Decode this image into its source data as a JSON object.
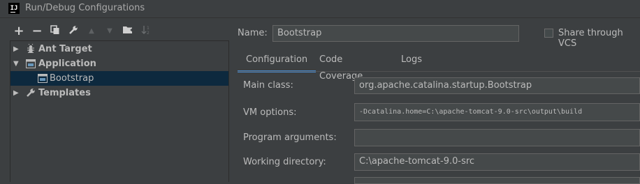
{
  "window": {
    "title": "Run/Debug Configurations",
    "logo_text": "IJ"
  },
  "toolbar": {
    "add": "+",
    "remove": "−",
    "copy": "⧉",
    "wrench": "🔧",
    "up": "▲",
    "down": "▼",
    "folder": "📁",
    "sort": "↓²"
  },
  "tree": {
    "items": [
      {
        "label": "Ant Target",
        "icon": "ant-icon"
      },
      {
        "label": "Application",
        "icon": "application-icon"
      },
      {
        "label": "Bootstrap",
        "icon": "application-config-icon"
      },
      {
        "label": "Templates",
        "icon": "wrench-icon"
      }
    ]
  },
  "form": {
    "name_label": "Name:",
    "name_value": "Bootstrap",
    "share_label": "Share through VCS",
    "tabs": [
      "Configuration",
      "Code Coverage",
      "Logs"
    ],
    "main_class_label": "Main class:",
    "main_class_value": "org.apache.catalina.startup.Bootstrap",
    "vm_options_label": "VM options:",
    "vm_options_value": "-Dcatalina.home=C:\\apache-tomcat-9.0-src\\output\\build",
    "program_args_label": "Program arguments:",
    "program_args_value": "",
    "working_dir_label": "Working directory:",
    "working_dir_value": "C:\\apache-tomcat-9.0-src"
  },
  "colors": {
    "background": "#3c3f41",
    "selection": "#0d293e",
    "accent": "#4a88c7",
    "field": "#45494a"
  }
}
